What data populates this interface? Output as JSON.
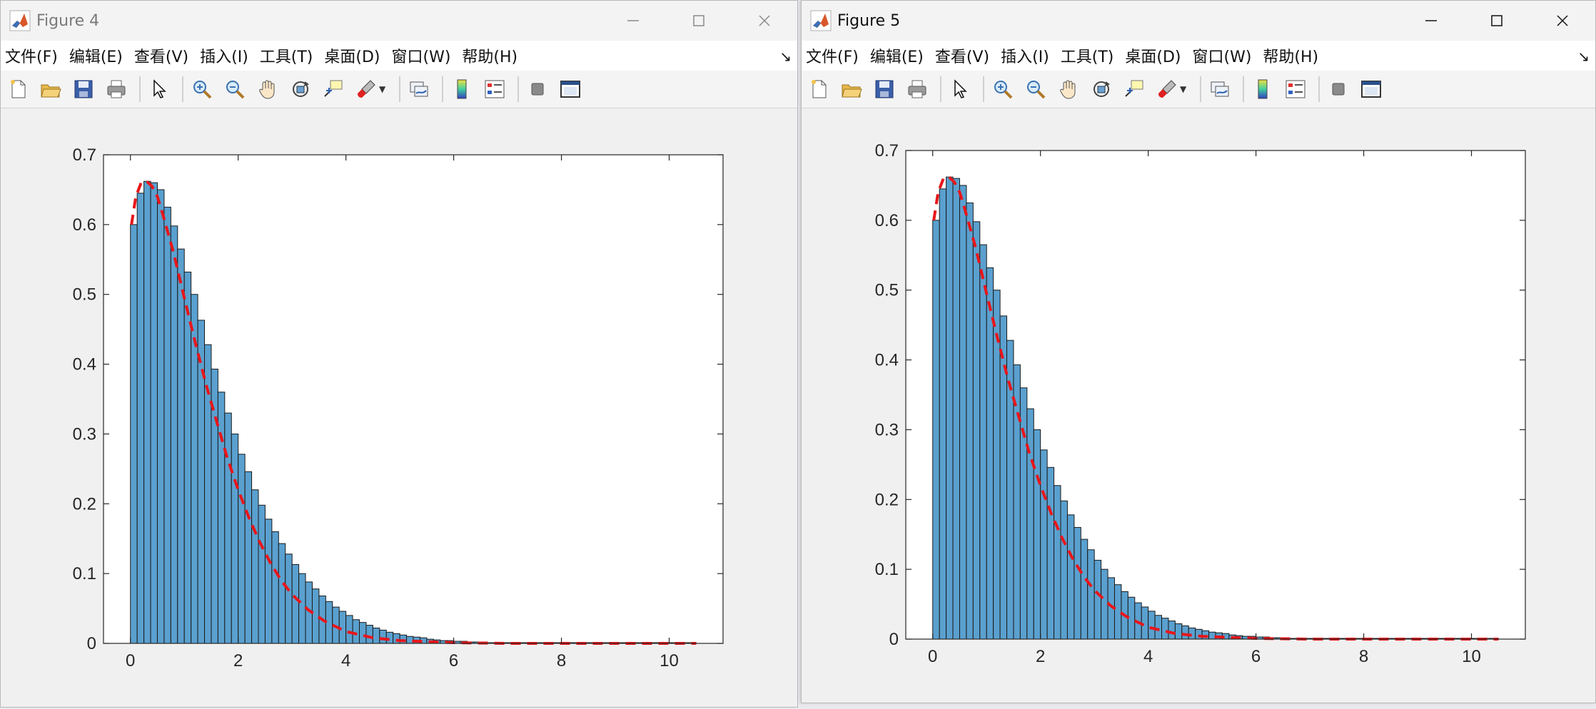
{
  "windows": [
    {
      "title": "Figure 4",
      "active": false,
      "menus": [
        "文件(F)",
        "编辑(E)",
        "查看(V)",
        "插入(I)",
        "工具(T)",
        "桌面(D)",
        "窗口(W)",
        "帮助(H)"
      ],
      "toolbar_icons": [
        "new-figure-icon",
        "open-file-icon",
        "save-icon",
        "print-icon",
        "select-arrow-icon",
        "zoom-in-icon",
        "zoom-out-icon",
        "pan-hand-icon",
        "rotate-3d-icon",
        "data-cursor-icon",
        "brush-icon",
        "link-plot-icon",
        "colorbar-icon",
        "legend-icon",
        "hide-plot-tools-icon",
        "show-plot-tools-icon"
      ]
    },
    {
      "title": "Figure 5",
      "active": true,
      "menus": [
        "文件(F)",
        "编辑(E)",
        "查看(V)",
        "插入(I)",
        "工具(T)",
        "桌面(D)",
        "窗口(W)",
        "帮助(H)"
      ],
      "toolbar_icons": [
        "new-figure-icon",
        "open-file-icon",
        "save-icon",
        "print-icon",
        "select-arrow-icon",
        "zoom-in-icon",
        "zoom-out-icon",
        "pan-hand-icon",
        "rotate-3d-icon",
        "data-cursor-icon",
        "brush-icon",
        "link-plot-icon",
        "colorbar-icon",
        "legend-icon",
        "hide-plot-tools-icon",
        "show-plot-tools-icon"
      ]
    }
  ],
  "colors": {
    "bar_fill": "#5aa0cf",
    "bar_edge": "#1a1a1a",
    "curve": "#e8161a",
    "axes_bg": "#ffffff"
  },
  "chart_data": [
    {
      "type": "bar",
      "title": "",
      "xlabel": "",
      "ylabel": "",
      "xlim": [
        -0.5,
        11.0
      ],
      "ylim": [
        0,
        0.7
      ],
      "xticks": [
        0,
        2,
        4,
        6,
        8,
        10
      ],
      "yticks": [
        0,
        0.1,
        0.2,
        0.3,
        0.4,
        0.5,
        0.6,
        0.7
      ],
      "xtick_labels": [
        "0",
        "2",
        "4",
        "6",
        "8",
        "10"
      ],
      "ytick_labels": [
        "0",
        "0.1",
        "0.2",
        "0.3",
        "0.4",
        "0.5",
        "0.6",
        "0.7"
      ],
      "grid": false,
      "bin_width": 0.125,
      "bin_start": 0,
      "values": [
        0.6,
        0.645,
        0.662,
        0.66,
        0.65,
        0.625,
        0.598,
        0.565,
        0.532,
        0.5,
        0.463,
        0.428,
        0.393,
        0.36,
        0.33,
        0.3,
        0.271,
        0.246,
        0.22,
        0.198,
        0.178,
        0.16,
        0.143,
        0.128,
        0.113,
        0.1,
        0.088,
        0.078,
        0.068,
        0.06,
        0.052,
        0.046,
        0.04,
        0.034,
        0.03,
        0.026,
        0.022,
        0.019,
        0.016,
        0.014,
        0.012,
        0.01,
        0.009,
        0.008,
        0.006,
        0.005,
        0.004,
        0.004,
        0.003,
        0.003,
        0.002,
        0.002,
        0.002,
        0.001,
        0.001,
        0.001,
        0.001,
        0.001,
        0.001,
        0.001,
        0.001,
        0.001,
        0.001,
        0.001,
        0.001,
        0.001,
        0.001,
        0.001,
        0.001,
        0.001,
        0.001,
        0.001,
        0.001,
        0.001,
        0.001,
        0.001,
        0.001,
        0.001,
        0.001,
        0.001,
        0.001,
        0.001,
        0.001,
        0.001
      ],
      "curve": {
        "style": "dashed",
        "x": [
          0.02,
          0.1,
          0.2,
          0.3,
          0.4,
          0.5,
          0.6,
          0.8,
          1.0,
          1.2,
          1.4,
          1.6,
          1.8,
          2.0,
          2.2,
          2.4,
          2.6,
          2.8,
          3.0,
          3.3,
          3.6,
          4.0,
          4.5,
          5.0,
          6.0,
          7.0,
          8.0,
          9.0,
          10.0,
          10.5
        ],
        "y": [
          0.6,
          0.64,
          0.66,
          0.662,
          0.655,
          0.64,
          0.615,
          0.56,
          0.495,
          0.432,
          0.372,
          0.318,
          0.265,
          0.22,
          0.18,
          0.145,
          0.115,
          0.09,
          0.07,
          0.048,
          0.032,
          0.017,
          0.008,
          0.004,
          0.001,
          0.0,
          0.0,
          0.0,
          0.0,
          0.0
        ]
      }
    },
    {
      "type": "bar",
      "title": "",
      "xlabel": "",
      "ylabel": "",
      "xlim": [
        -0.5,
        11.0
      ],
      "ylim": [
        0,
        0.7
      ],
      "xticks": [
        0,
        2,
        4,
        6,
        8,
        10
      ],
      "yticks": [
        0,
        0.1,
        0.2,
        0.3,
        0.4,
        0.5,
        0.6,
        0.7
      ],
      "xtick_labels": [
        "0",
        "2",
        "4",
        "6",
        "8",
        "10"
      ],
      "ytick_labels": [
        "0",
        "0.1",
        "0.2",
        "0.3",
        "0.4",
        "0.5",
        "0.6",
        "0.7"
      ],
      "grid": false,
      "bin_width": 0.125,
      "bin_start": 0,
      "values": [
        0.6,
        0.645,
        0.662,
        0.66,
        0.65,
        0.625,
        0.598,
        0.565,
        0.532,
        0.5,
        0.463,
        0.428,
        0.393,
        0.36,
        0.33,
        0.3,
        0.271,
        0.246,
        0.22,
        0.198,
        0.178,
        0.16,
        0.143,
        0.128,
        0.113,
        0.1,
        0.088,
        0.078,
        0.068,
        0.06,
        0.052,
        0.046,
        0.04,
        0.034,
        0.03,
        0.026,
        0.022,
        0.019,
        0.016,
        0.014,
        0.012,
        0.01,
        0.009,
        0.008,
        0.006,
        0.005,
        0.004,
        0.004,
        0.003,
        0.003,
        0.002,
        0.002,
        0.002,
        0.001,
        0.001,
        0.001,
        0.001,
        0.001,
        0.001,
        0.001,
        0.001,
        0.001,
        0.001,
        0.001,
        0.001,
        0.001,
        0.001,
        0.001,
        0.001,
        0.001,
        0.001,
        0.001,
        0.001,
        0.001,
        0.001,
        0.001,
        0.001,
        0.001,
        0.001,
        0.001,
        0.001,
        0.001,
        0.001,
        0.001
      ],
      "curve": {
        "style": "dashed",
        "x": [
          0.02,
          0.1,
          0.2,
          0.3,
          0.4,
          0.5,
          0.6,
          0.8,
          1.0,
          1.2,
          1.4,
          1.6,
          1.8,
          2.0,
          2.2,
          2.4,
          2.6,
          2.8,
          3.0,
          3.3,
          3.6,
          4.0,
          4.5,
          5.0,
          6.0,
          7.0,
          8.0,
          9.0,
          10.0,
          10.5
        ],
        "y": [
          0.6,
          0.64,
          0.66,
          0.662,
          0.655,
          0.64,
          0.615,
          0.56,
          0.495,
          0.432,
          0.372,
          0.318,
          0.265,
          0.22,
          0.18,
          0.145,
          0.115,
          0.09,
          0.07,
          0.048,
          0.032,
          0.017,
          0.008,
          0.004,
          0.001,
          0.0,
          0.0,
          0.0,
          0.0,
          0.0
        ]
      }
    }
  ]
}
